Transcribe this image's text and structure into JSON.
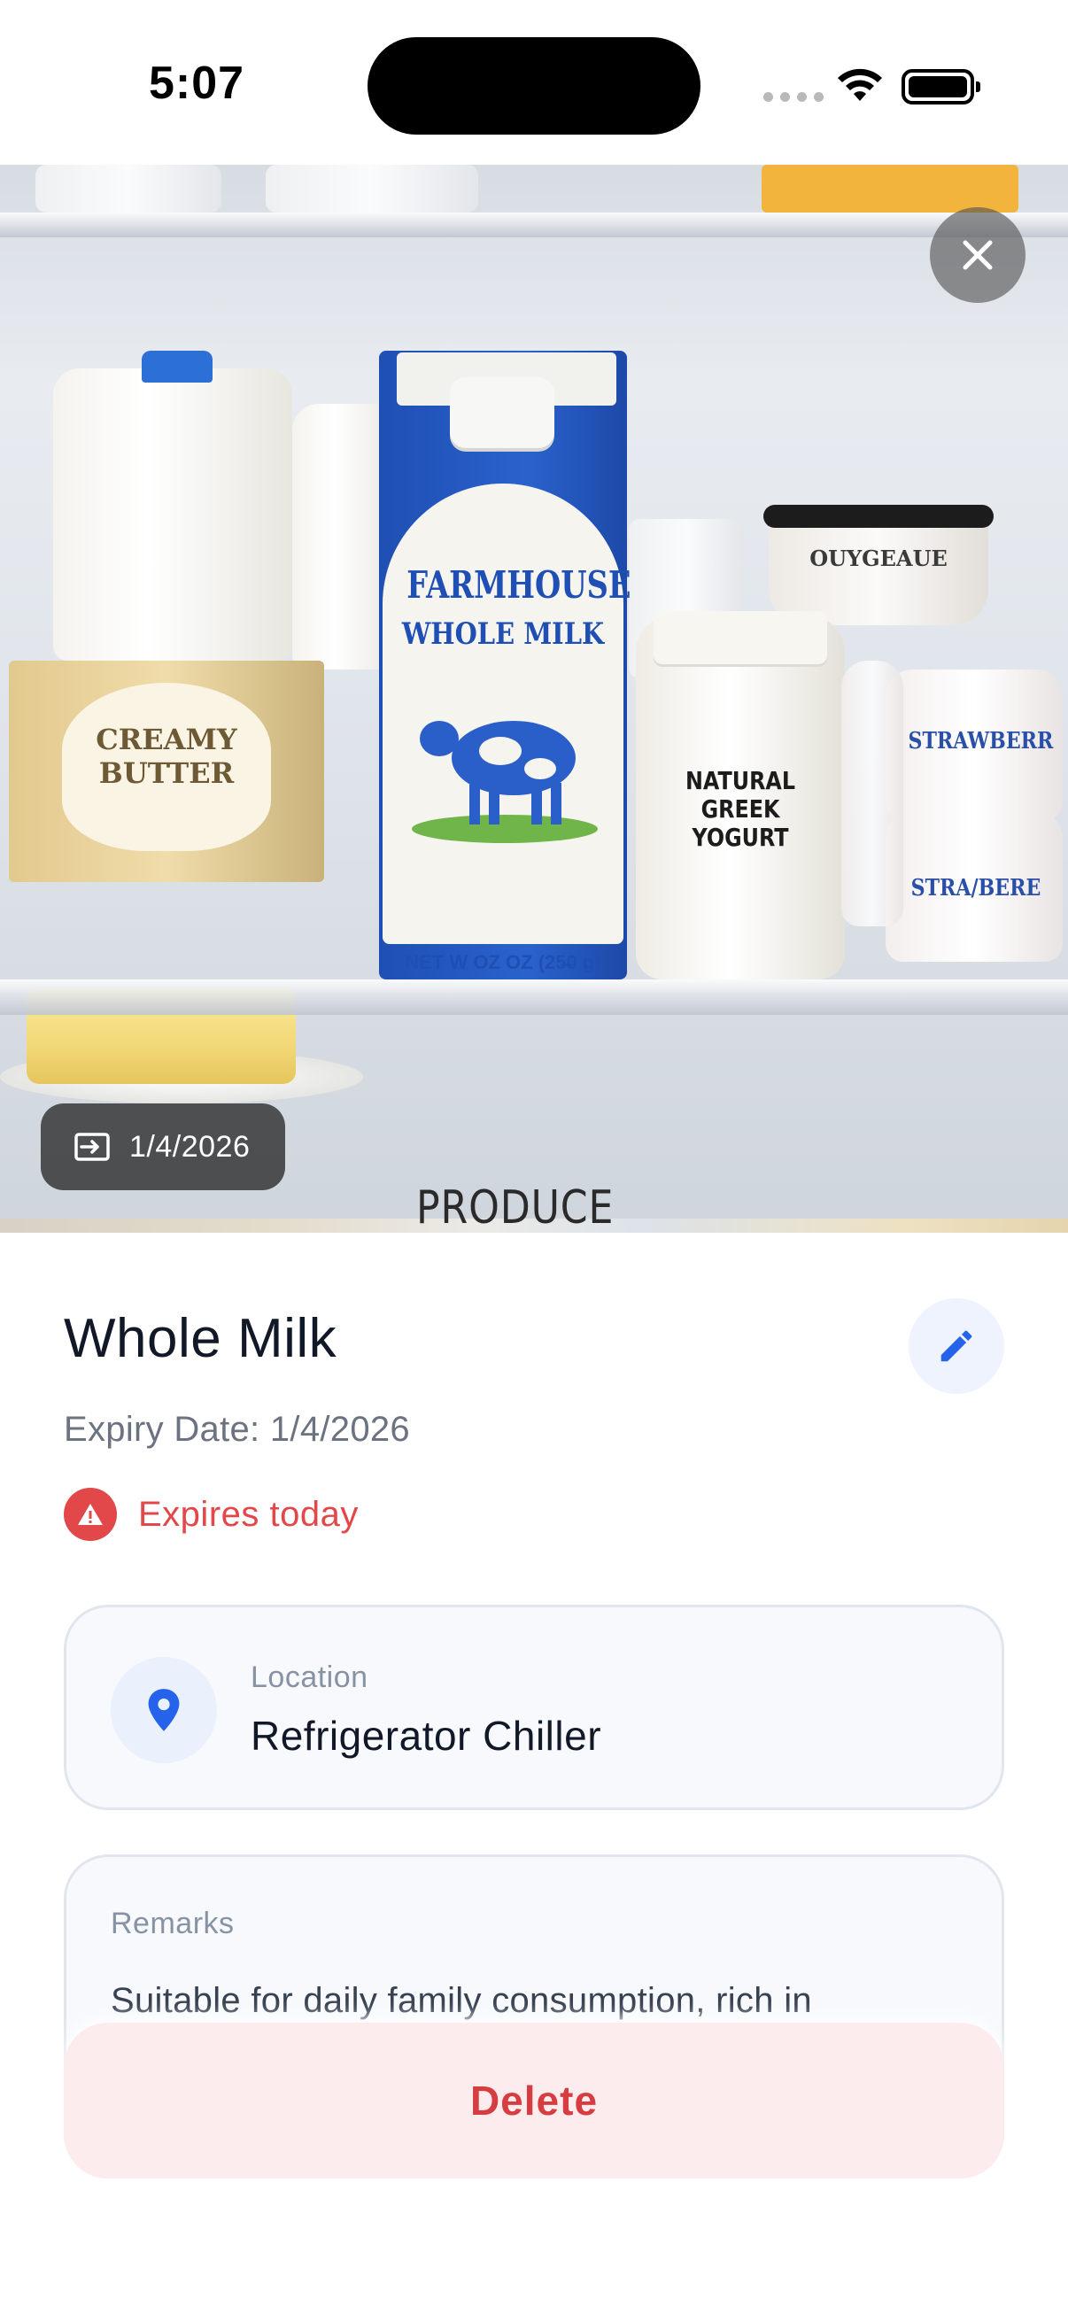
{
  "status_bar": {
    "time": "5:07"
  },
  "photo": {
    "carton_brand": "FARMHOUSE",
    "carton_product": "WHOLE MILK",
    "carton_net": "NET W OZ OZ (25̶0 g)",
    "butter_label_1": "CREAMY",
    "butter_label_2": "BUTTER",
    "yogurt_label_1": "NATURAL",
    "yogurt_label_2": "GREEK",
    "yogurt_label_3": "YOGURT",
    "cup_label_1": "STRAWBERR",
    "cup_label_2": "STRA/BERE",
    "tub_label": "OUYGEAUE",
    "drawer_label": "PRODUCE",
    "added_date": "1/4/2026",
    "close_icon": "close-icon",
    "calendar_icon": "date-added-icon"
  },
  "item": {
    "name": "Whole Milk",
    "expiry_line": "Expiry Date: 1/4/2026",
    "warning": "Expires today",
    "edit_icon": "pencil-icon",
    "warning_icon": "warning-icon"
  },
  "location": {
    "label": "Location",
    "value": "Refrigerator Chiller",
    "icon": "location-pin-icon"
  },
  "remarks": {
    "label": "Remarks",
    "text": "Suitable for daily family consumption, rich in"
  },
  "actions": {
    "delete_label": "Delete"
  },
  "colors": {
    "accent": "#2563eb",
    "danger": "#e2474a",
    "delete_bg": "#fdeced",
    "delete_text": "#d63c40"
  }
}
